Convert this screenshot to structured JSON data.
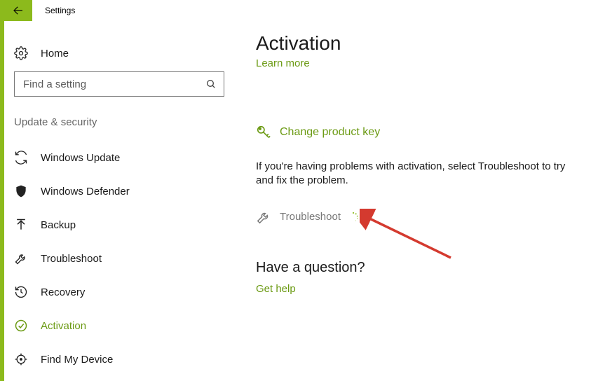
{
  "titlebar": {
    "title": "Settings"
  },
  "sidebar": {
    "home_label": "Home",
    "search_placeholder": "Find a setting",
    "section_header": "Update & security",
    "items": [
      {
        "label": "Windows Update"
      },
      {
        "label": "Windows Defender"
      },
      {
        "label": "Backup"
      },
      {
        "label": "Troubleshoot"
      },
      {
        "label": "Recovery"
      },
      {
        "label": "Activation"
      },
      {
        "label": "Find My Device"
      }
    ]
  },
  "main": {
    "page_title": "Activation",
    "learn_more": "Learn more",
    "change_key": "Change product key",
    "trouble_text": "If you're having problems with activation, select Troubleshoot to try and fix the problem.",
    "troubleshoot": "Troubleshoot",
    "question": "Have a question?",
    "get_help": "Get help"
  }
}
